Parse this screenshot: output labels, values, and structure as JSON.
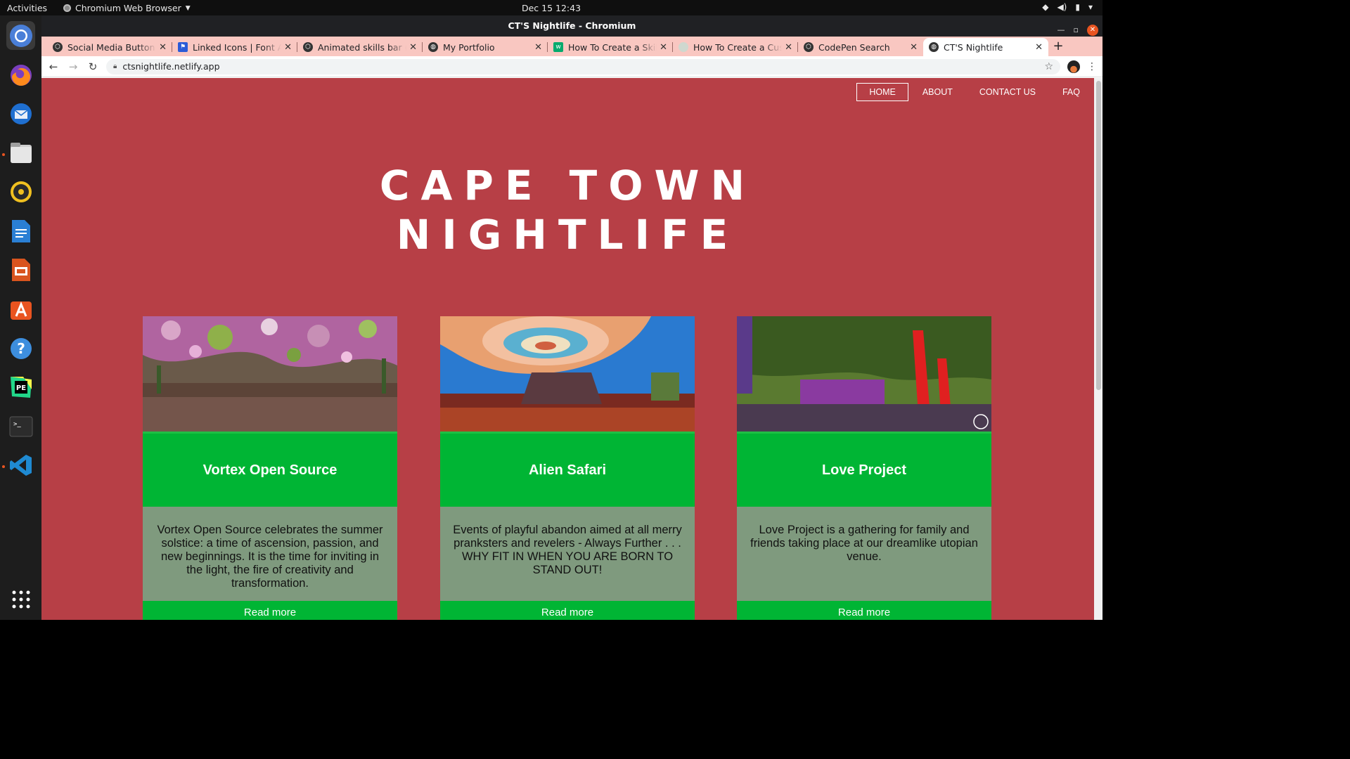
{
  "system": {
    "activities": "Activities",
    "app_name": "Chromium Web Browser",
    "clock": "Dec 15  12:43"
  },
  "window": {
    "title": "CT'S Nightlife - Chromium"
  },
  "tabs": [
    {
      "label": "Social Media Button Hover",
      "icon": "codepen-icon"
    },
    {
      "label": "Linked Icons | Font Awesome",
      "icon": "font-awesome-flag-icon"
    },
    {
      "label": "Animated skills bar (HTML)",
      "icon": "codepen-icon"
    },
    {
      "label": "My Portfolio",
      "icon": "globe-icon"
    },
    {
      "label": "How To Create a Skill Bar",
      "icon": "w3schools-icon"
    },
    {
      "label": "How To Create a Custom",
      "icon": "blank-page-icon"
    },
    {
      "label": "CodePen Search",
      "icon": "codepen-icon"
    },
    {
      "label": "CT'S Nightlife",
      "icon": "globe-icon",
      "active": true
    }
  ],
  "address_bar": {
    "url": "ctsnightlife.netlify.app"
  },
  "site": {
    "nav": [
      "HOME",
      "ABOUT",
      "CONTACT US",
      "FAQ"
    ],
    "title_line1": "CAPE TOWN",
    "title_line2": "NIGHTLIFE",
    "cards": [
      {
        "name": "Vortex Open Source",
        "description": "Vortex Open Source celebrates the summer solstice: a time of ascension, passion, and new beginnings. It is the time for inviting in the light, the fire of creativity and transformation.",
        "link": "Read more"
      },
      {
        "name": "Alien Safari",
        "description": "Events of playful abandon aimed at all merry pranksters and revelers - Always Further . . . WHY FIT IN WHEN YOU ARE BORN TO STAND OUT!",
        "link": "Read more"
      },
      {
        "name": "Love Project",
        "description": "Love Project is a gathering for family and friends taking place at our dreamlike utopian venue.",
        "link": "Read more"
      }
    ]
  },
  "colors": {
    "page_bg": "#b73f46",
    "card_title_bg": "#00b534",
    "card_desc_bg": "#7f9a7e",
    "tabstrip_bg": "#f9c7c1"
  }
}
